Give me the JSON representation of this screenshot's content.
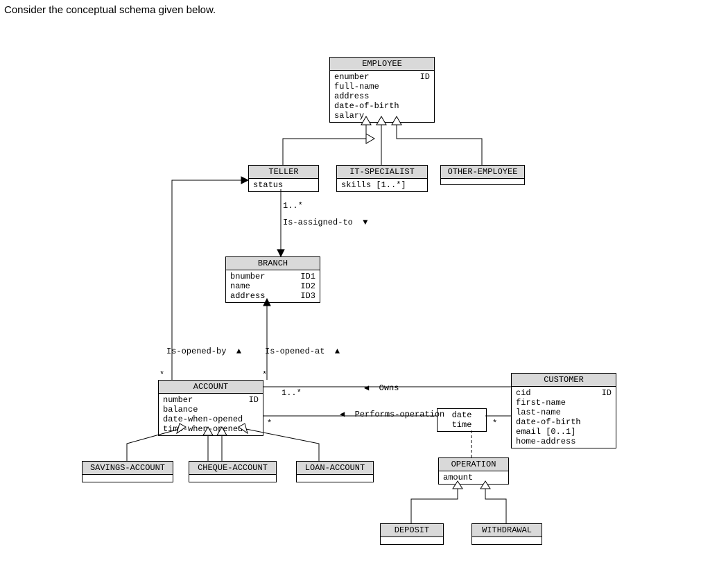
{
  "instruction": "Consider the conceptual schema given below.",
  "employee": {
    "title": "EMPLOYEE",
    "attrs": [
      {
        "name": "enumber",
        "tag": "ID"
      },
      {
        "name": "full-name"
      },
      {
        "name": "address"
      },
      {
        "name": "date-of-birth"
      },
      {
        "name": "salary"
      }
    ]
  },
  "teller": {
    "title": "TELLER",
    "attrs": [
      {
        "name": "status"
      }
    ]
  },
  "it_specialist": {
    "title": "IT-SPECIALIST",
    "attrs": [
      {
        "name": "skills [1..*]"
      }
    ]
  },
  "other_employee": {
    "title": "OTHER-EMPLOYEE",
    "attrs": []
  },
  "branch": {
    "title": "BRANCH",
    "attrs": [
      {
        "name": "bnumber",
        "tag": "ID1"
      },
      {
        "name": "name",
        "tag": "ID2"
      },
      {
        "name": "address",
        "tag": "ID3"
      }
    ]
  },
  "account": {
    "title": "ACCOUNT",
    "attrs": [
      {
        "name": "number",
        "tag": "ID"
      },
      {
        "name": "balance"
      },
      {
        "name": "date-when-opened"
      },
      {
        "name": "time-when-opened"
      }
    ]
  },
  "customer": {
    "title": "CUSTOMER",
    "attrs": [
      {
        "name": "cid",
        "tag": "ID"
      },
      {
        "name": "first-name"
      },
      {
        "name": "last-name"
      },
      {
        "name": "date-of-birth"
      },
      {
        "name": "email [0..1]"
      },
      {
        "name": "home-address"
      }
    ]
  },
  "savings": {
    "title": "SAVINGS-ACCOUNT",
    "attrs": []
  },
  "cheque": {
    "title": "CHEQUE-ACCOUNT",
    "attrs": []
  },
  "loan": {
    "title": "LOAN-ACCOUNT",
    "attrs": []
  },
  "operation": {
    "title": "OPERATION",
    "attrs": [
      {
        "name": "amount"
      }
    ]
  },
  "deposit": {
    "title": "DEPOSIT",
    "attrs": []
  },
  "withdrawal": {
    "title": "WITHDRAWAL",
    "attrs": []
  },
  "labels": {
    "is_assigned_to": "Is-assigned-to",
    "is_opened_by": "Is-opened-by",
    "is_opened_at": "Is-opened-at",
    "owns": "Owns",
    "performs": "Performs-operation",
    "qualifiers": {
      "date": "date",
      "time": "time"
    }
  },
  "mult": {
    "teller_branch_top": "1..*",
    "account_owns": "1..*",
    "account_performs": "*",
    "customer_performs": "*",
    "account_left": "*",
    "account_right": "*"
  },
  "chart_data": {
    "type": "diagram",
    "diagram_kind": "UML-class-diagram",
    "classes": [
      {
        "name": "EMPLOYEE",
        "attributes": [
          "enumber {ID}",
          "full-name",
          "address",
          "date-of-birth",
          "salary"
        ]
      },
      {
        "name": "TELLER",
        "superclass": "EMPLOYEE",
        "attributes": [
          "status"
        ]
      },
      {
        "name": "IT-SPECIALIST",
        "superclass": "EMPLOYEE",
        "attributes": [
          "skills [1..*]"
        ]
      },
      {
        "name": "OTHER-EMPLOYEE",
        "superclass": "EMPLOYEE",
        "attributes": []
      },
      {
        "name": "BRANCH",
        "attributes": [
          "bnumber {ID1}",
          "name {ID2}",
          "address {ID3}"
        ]
      },
      {
        "name": "ACCOUNT",
        "attributes": [
          "number {ID}",
          "balance",
          "date-when-opened",
          "time-when-opened"
        ]
      },
      {
        "name": "SAVINGS-ACCOUNT",
        "superclass": "ACCOUNT",
        "attributes": []
      },
      {
        "name": "CHEQUE-ACCOUNT",
        "superclass": "ACCOUNT",
        "attributes": []
      },
      {
        "name": "LOAN-ACCOUNT",
        "superclass": "ACCOUNT",
        "attributes": []
      },
      {
        "name": "CUSTOMER",
        "attributes": [
          "cid {ID}",
          "first-name",
          "last-name",
          "date-of-birth",
          "email [0..1]",
          "home-address"
        ]
      },
      {
        "name": "OPERATION",
        "attributes": [
          "amount"
        ]
      },
      {
        "name": "DEPOSIT",
        "superclass": "OPERATION",
        "attributes": []
      },
      {
        "name": "WITHDRAWAL",
        "superclass": "OPERATION",
        "attributes": []
      }
    ],
    "associations": [
      {
        "name": "Is-assigned-to",
        "ends": [
          "TELLER {1..*}",
          "BRANCH"
        ],
        "navigable_toward": "BRANCH"
      },
      {
        "name": "Is-opened-by",
        "ends": [
          "ACCOUNT {*}",
          "TELLER"
        ],
        "navigable_toward": "TELLER"
      },
      {
        "name": "Is-opened-at",
        "ends": [
          "ACCOUNT {*}",
          "BRANCH"
        ],
        "navigable_toward": "BRANCH"
      },
      {
        "name": "Owns",
        "ends": [
          "ACCOUNT {1..*}",
          "CUSTOMER"
        ],
        "navigable_toward": "ACCOUNT"
      },
      {
        "name": "Performs-operation",
        "ends": [
          "ACCOUNT {*}",
          "CUSTOMER {*}"
        ],
        "association_class": "OPERATION",
        "qualifiers_at_CUSTOMER": [
          "date",
          "time"
        ],
        "navigable_toward": "ACCOUNT"
      }
    ]
  }
}
